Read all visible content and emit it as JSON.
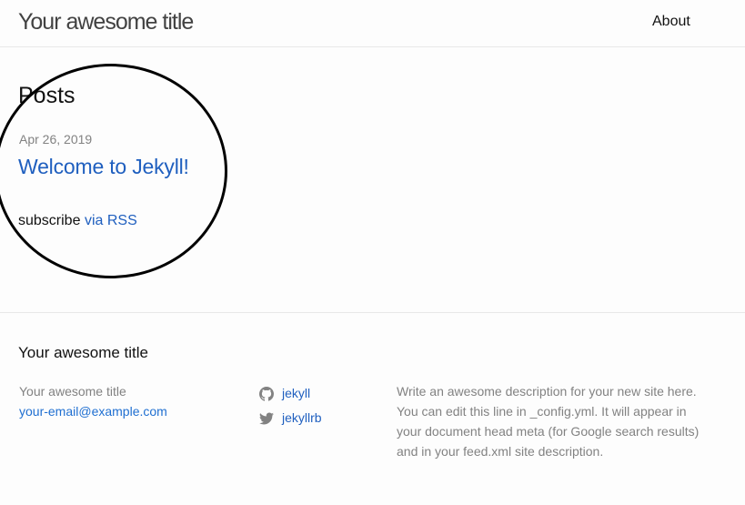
{
  "header": {
    "site_title": "Your awesome title",
    "nav": {
      "about": "About"
    }
  },
  "main": {
    "heading": "Posts",
    "posts": [
      {
        "date": "Apr 26, 2019",
        "title": "Welcome to Jekyll!"
      }
    ],
    "rss": {
      "prefix": "subscribe",
      "link_text": "via RSS"
    }
  },
  "footer": {
    "heading": "Your awesome title",
    "contact": {
      "name": "Your awesome title",
      "email": "your-email@example.com"
    },
    "social": [
      {
        "icon": "github-icon",
        "label": "jekyll"
      },
      {
        "icon": "twitter-icon",
        "label": "jekyllrb"
      }
    ],
    "description": "Write an awesome description for your new site here. You can edit this line in _config.yml. It will appear in your document head meta (for Google search results) and in your feed.xml site description."
  },
  "colors": {
    "link": "#1f5fbf",
    "muted": "#828282",
    "text": "#111111",
    "border": "#e8e8e8",
    "annotation": "#000000"
  }
}
